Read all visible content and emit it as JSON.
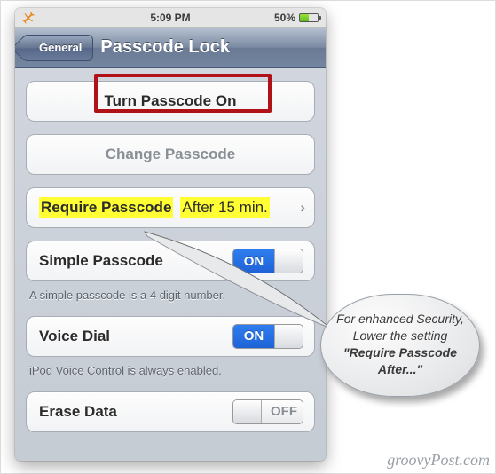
{
  "statusbar": {
    "time": "5:09 PM",
    "battery_pct": "50%"
  },
  "nav": {
    "back": "General",
    "title": "Passcode Lock"
  },
  "cells": {
    "turn_on": "Turn Passcode On",
    "change": "Change Passcode",
    "require_label": "Require Passcode",
    "require_value": "After 15 min.",
    "simple_label": "Simple Passcode",
    "simple_note": "A simple passcode is a 4 digit number.",
    "voice_label": "Voice Dial",
    "voice_note": "iPod Voice Control is always enabled.",
    "erase_label": "Erase Data"
  },
  "toggle": {
    "on": "ON",
    "off": "OFF"
  },
  "callout": {
    "text_pre": "For enhanced Security, Lower the setting ",
    "text_quote": "\"Require Passcode After...\""
  },
  "watermark": "groovyPost.com"
}
